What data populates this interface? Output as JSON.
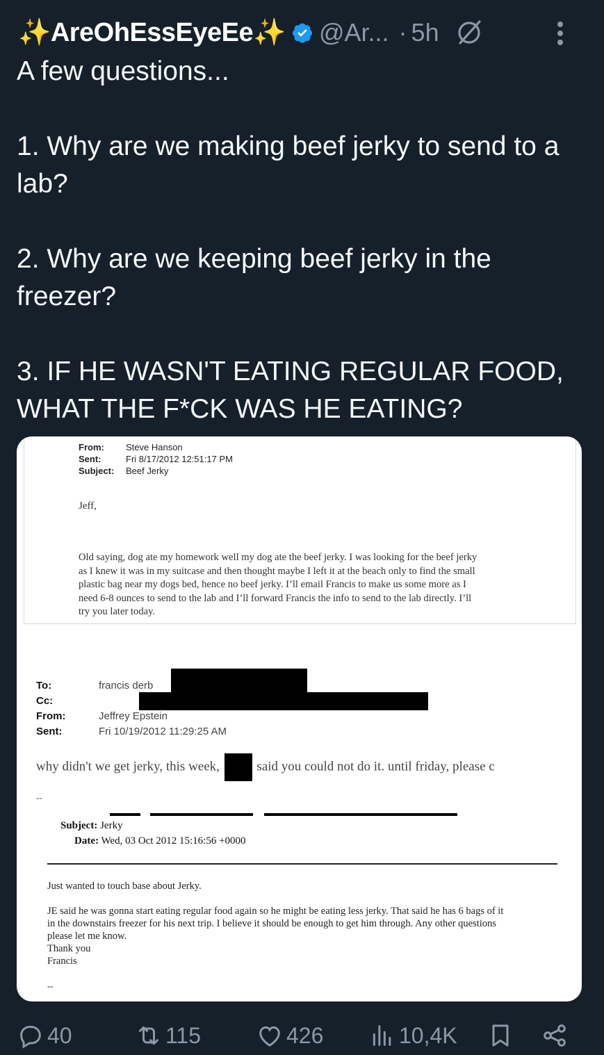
{
  "header": {
    "display_name": "✨AreOhEssEyeEe✨",
    "handle": "@Ar...",
    "separator": "·",
    "time": "5h",
    "verified_icon": "verified-badge-icon",
    "grok_icon": "grok-icon",
    "more_icon": "more-vertical-icon"
  },
  "tweet": {
    "lines": [
      "A few questions...",
      "1. Why are we making beef jerky to send to a lab?",
      "2. Why are we keeping beef jerky in the freezer?",
      "3. IF HE WASN'T EATING REGULAR FOOD, WHAT THE F*CK WAS HE EATING?"
    ]
  },
  "media": {
    "email1": {
      "from_label": "From:",
      "from_value": "Steve Hanson",
      "sent_label": "Sent:",
      "sent_value": "Fri 8/17/2012 12:51:17 PM",
      "subject_label": "Subject:",
      "subject_value": "Beef Jerky",
      "salutation": "Jeff,",
      "body": [
        "Old saying, dog ate my homework well my dog ate the beef jerky. I was looking for the beef jerky",
        "as I knew it was in my suitcase and then thought maybe I left it at the beach only to find the small",
        "plastic bag near my dogs bed, hence no beef jerky. I’ll email Francis to make us some more as I",
        "need 6-8 ounces to send to the lab and I’ll forward Francis the info to send to the lab directly. I’ll",
        "try you later today."
      ]
    },
    "email2": {
      "to_label": "To:",
      "to_value": "francis derb",
      "cc_label": "Cc:",
      "from_label": "From:",
      "from_value": "Jeffrey Epstein",
      "sent_label": "Sent:",
      "sent_value": "Fri 10/19/2012 11:29:25 AM",
      "body_part1": "why didn't we get jerky, this week,",
      "body_part2": "said you could not do it. until friday,   please c",
      "dashes": "--"
    },
    "email3": {
      "subject_label": "Subject:",
      "subject_value": "Jerky",
      "date_label": "Date:",
      "date_value": "Wed, 03 Oct 2012 15:16:56 +0000",
      "intro": "Just wanted to touch base about Jerky.",
      "body": [
        "JE said he was gonna start eating regular food again so he might be eating less jerky. That said he has 6 bags of it",
        "in the downstairs freezer for his next trip. I believe it should be enough to get him through. Any other questions",
        "please let me know.",
        "Thank you",
        "Francis"
      ],
      "dashes": "--"
    }
  },
  "actions": {
    "replies": "40",
    "reposts": "115",
    "likes": "426",
    "views": "10,4K"
  },
  "colors": {
    "background": "#15202b",
    "text": "#f7f9f9",
    "muted": "#8b98a5",
    "verified": "#1d9bf0"
  }
}
